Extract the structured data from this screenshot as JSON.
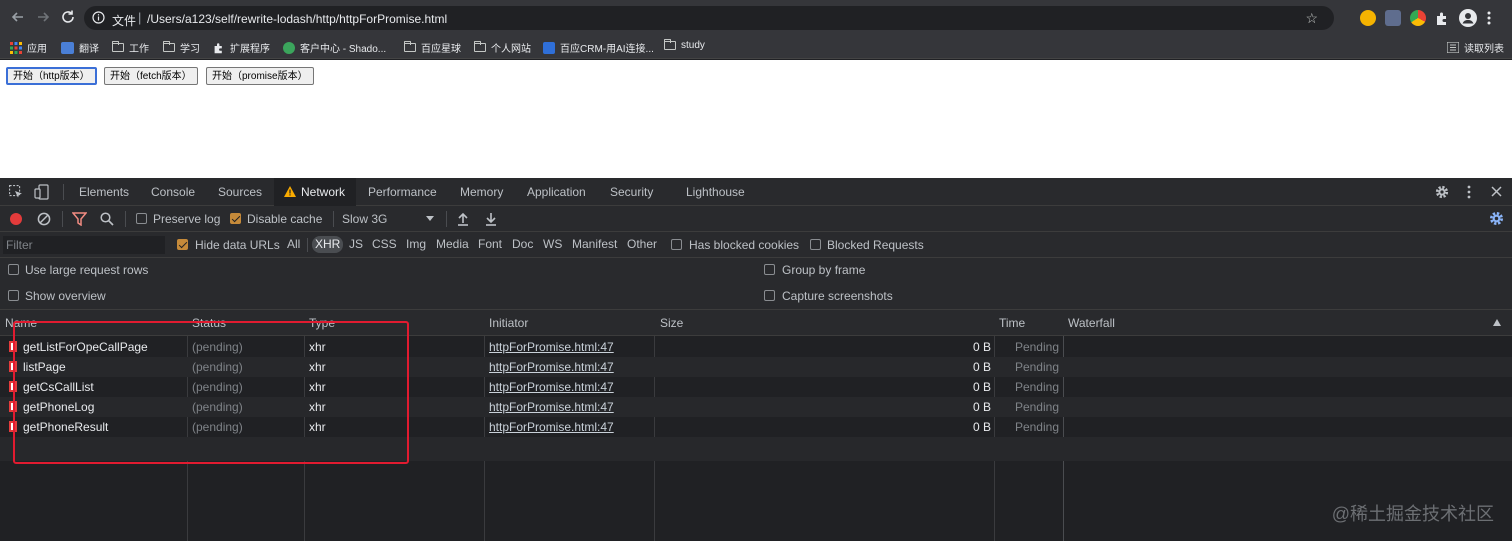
{
  "browser": {
    "url_scheme": "文件",
    "url_path": "/Users/a123/self/rewrite-lodash/http/httpForPromise.html",
    "reading_list": "读取列表"
  },
  "bookmarks": [
    {
      "label": "应用",
      "icon": "apps-grid-icon"
    },
    {
      "label": "翻译",
      "icon": "translate-icon"
    },
    {
      "label": "工作",
      "icon": "folder-icon"
    },
    {
      "label": "学习",
      "icon": "folder-icon"
    },
    {
      "label": "扩展程序",
      "icon": "puzzle-icon"
    },
    {
      "label": "客户中心 - Shado...",
      "icon": "shadowsocks-icon"
    },
    {
      "label": "百应星球",
      "icon": "folder-icon"
    },
    {
      "label": "个人网站",
      "icon": "folder-icon"
    },
    {
      "label": "百应CRM-用AI连接...",
      "icon": "crm-icon"
    },
    {
      "label": "study",
      "icon": "folder-icon"
    }
  ],
  "page": {
    "buttons": [
      "开始（http版本）",
      "开始（fetch版本）",
      "开始（promise版本）"
    ]
  },
  "devtools": {
    "tabs": [
      "Elements",
      "Console",
      "Sources",
      "Network",
      "Performance",
      "Memory",
      "Application",
      "Security",
      "Lighthouse"
    ],
    "active_tab": "Network",
    "toolbar": {
      "preserve_log": "Preserve log",
      "disable_cache": "Disable cache",
      "throttling": "Slow 3G"
    },
    "filter": {
      "placeholder": "Filter",
      "hide_data_urls": "Hide data URLs",
      "types": [
        "All",
        "XHR",
        "JS",
        "CSS",
        "Img",
        "Media",
        "Font",
        "Doc",
        "WS",
        "Manifest",
        "Other"
      ],
      "selected_type": "XHR",
      "has_blocked_cookies": "Has blocked cookies",
      "blocked_requests": "Blocked Requests"
    },
    "settings": {
      "large_rows": "Use large request rows",
      "show_overview": "Show overview",
      "group_by_frame": "Group by frame",
      "capture_screenshots": "Capture screenshots"
    },
    "columns": [
      "Name",
      "Status",
      "Type",
      "Initiator",
      "Size",
      "Time",
      "Waterfall"
    ],
    "requests": [
      {
        "name": "getListForOpeCallPage",
        "status": "(pending)",
        "type": "xhr",
        "initiator": "httpForPromise.html:47",
        "size": "0 B",
        "time": "Pending"
      },
      {
        "name": "listPage",
        "status": "(pending)",
        "type": "xhr",
        "initiator": "httpForPromise.html:47",
        "size": "0 B",
        "time": "Pending"
      },
      {
        "name": "getCsCallList",
        "status": "(pending)",
        "type": "xhr",
        "initiator": "httpForPromise.html:47",
        "size": "0 B",
        "time": "Pending"
      },
      {
        "name": "getPhoneLog",
        "status": "(pending)",
        "type": "xhr",
        "initiator": "httpForPromise.html:47",
        "size": "0 B",
        "time": "Pending"
      },
      {
        "name": "getPhoneResult",
        "status": "(pending)",
        "type": "xhr",
        "initiator": "httpForPromise.html:47",
        "size": "0 B",
        "time": "Pending"
      }
    ]
  },
  "watermark": "@稀土掘金技术社区",
  "colors": {
    "highlight": "#e11b30",
    "record": "#e33b3b",
    "checkbox": "#c58a3a",
    "filter_icon": "#f28b82",
    "settings_accent": "#8ab4f8"
  }
}
